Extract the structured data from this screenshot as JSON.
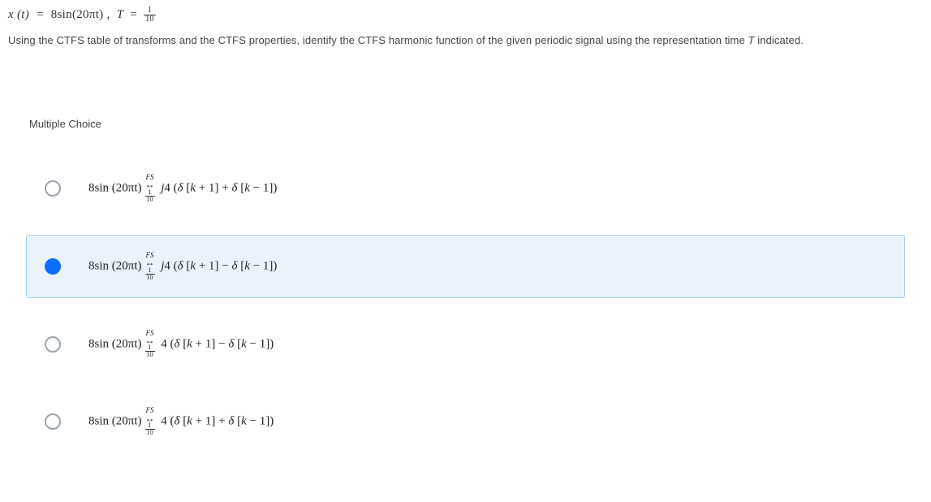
{
  "question": {
    "equation_lhs": "x (t)",
    "equals": "=",
    "equation_rhs": "8sin(20πt)",
    "comma": ",",
    "period_var": "T",
    "period_frac_num": "1",
    "period_frac_den": "10",
    "prompt": "Using the CTFS table of transforms and the CTFS properties, identify the CTFS harmonic function of the given periodic signal using the representation time ",
    "prompt_var": "T",
    "prompt_end": " indicated."
  },
  "section_label": "Multiple Choice",
  "fs_label": "FS",
  "arrow": "↔",
  "sub_frac_num": "1",
  "sub_frac_den": "10",
  "choices": [
    {
      "left": "8sin (20πt)",
      "right": "j4 (δ [k + 1] + δ [k − 1])",
      "selected": false
    },
    {
      "left": "8sin (20πt)",
      "right": "j4 (δ [k + 1] − δ [k − 1])",
      "selected": true
    },
    {
      "left": "8sin (20πt)",
      "right": "4 (δ [k + 1] − δ [k − 1])",
      "selected": false
    },
    {
      "left": "8sin (20πt)",
      "right": "4 (δ [k + 1] + δ [k − 1])",
      "selected": false
    }
  ]
}
